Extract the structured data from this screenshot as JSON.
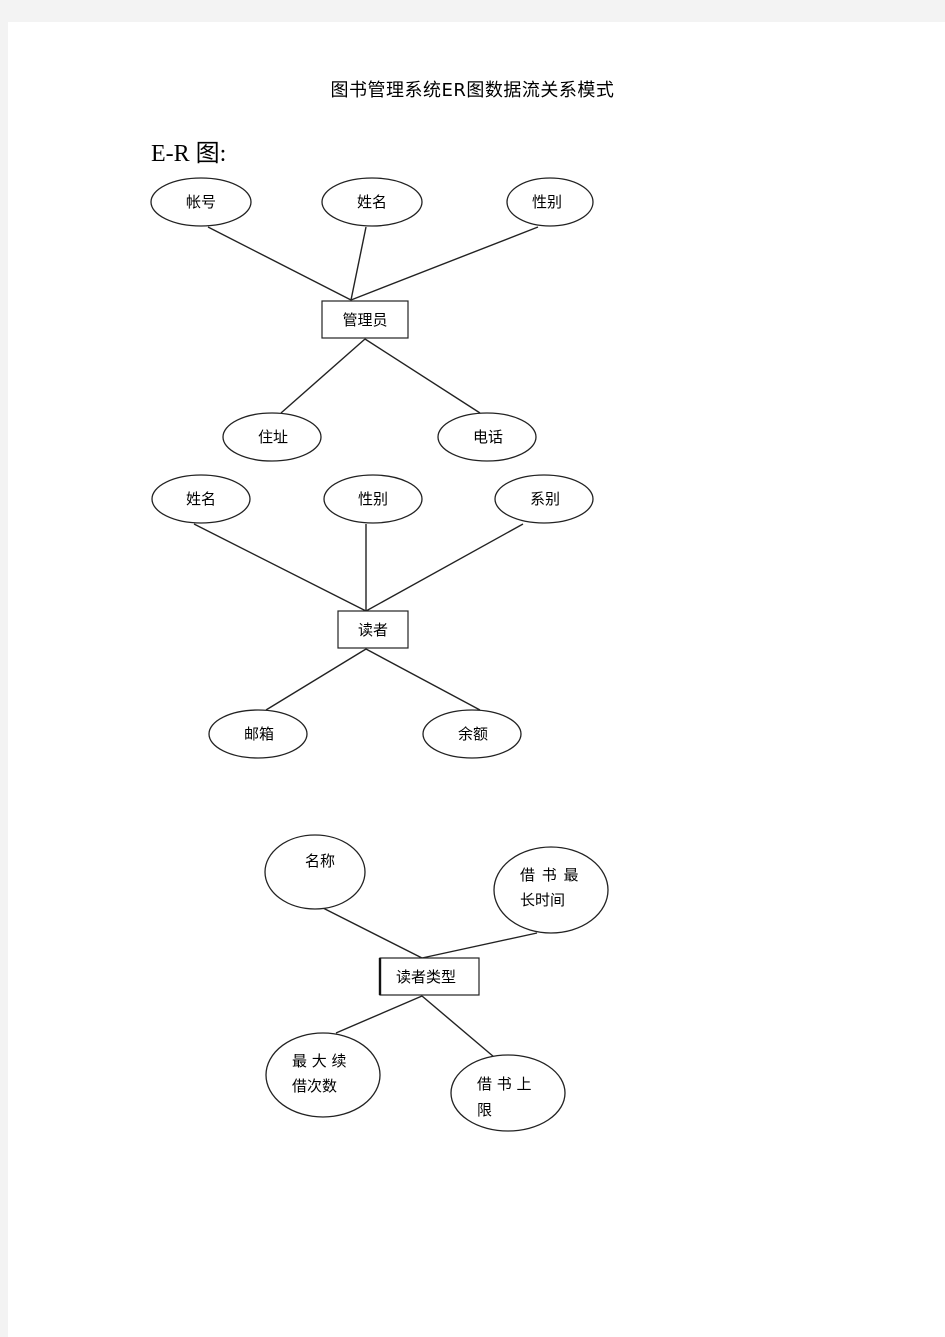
{
  "document": {
    "title": "图书管理系统ER图数据流关系模式",
    "section_heading": "E-R 图:"
  },
  "diagrams": [
    {
      "entity": "管理员",
      "attributes": [
        "帐号",
        "姓名",
        "性别",
        "住址",
        "电话"
      ]
    },
    {
      "entity": "读者",
      "attributes": [
        "姓名",
        "性别",
        "系别",
        "邮箱",
        "余额"
      ]
    },
    {
      "entity": "读者类型",
      "attributes": [
        [
          "名称"
        ],
        [
          "借 书 最",
          "长时间"
        ],
        [
          "最 大 续",
          "借次数"
        ],
        [
          "借 书 上",
          "限"
        ]
      ]
    }
  ]
}
